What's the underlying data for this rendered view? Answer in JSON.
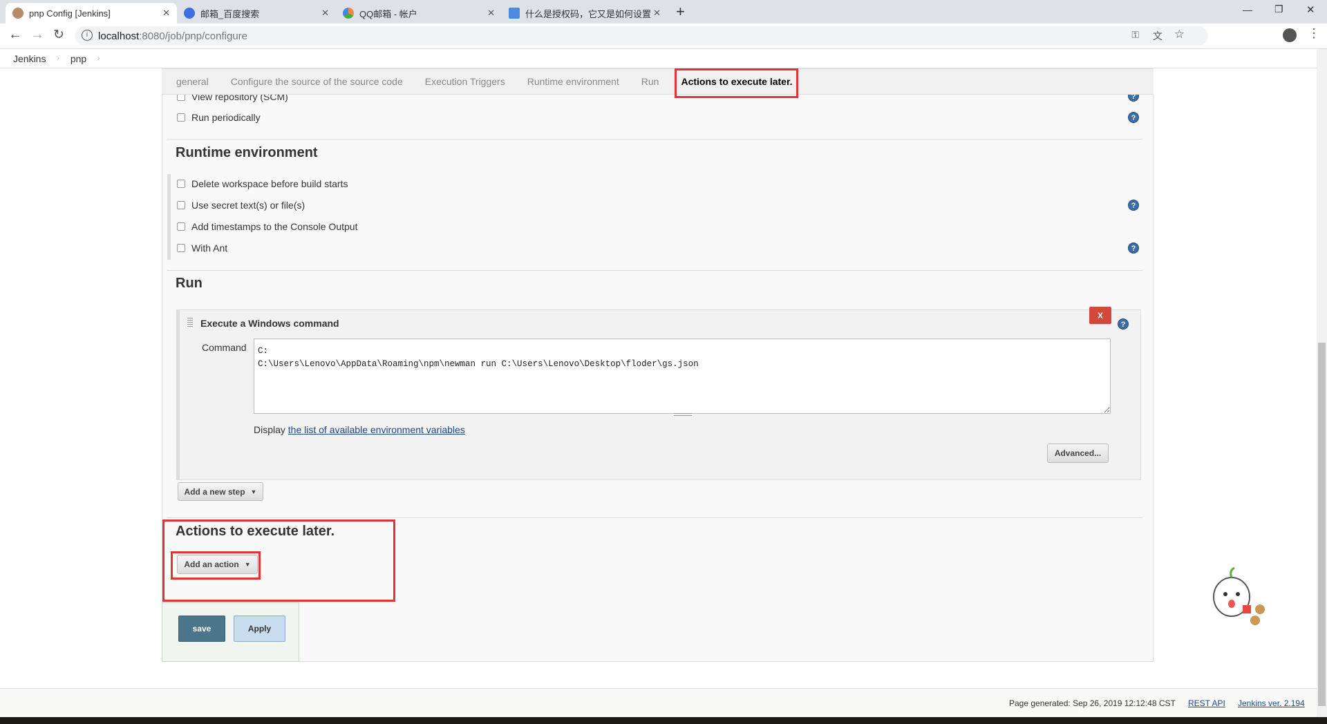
{
  "browser": {
    "tabs": [
      {
        "title": "pnp Config [Jenkins]",
        "active": true
      },
      {
        "title": "邮箱_百度搜索"
      },
      {
        "title": "QQ邮箱 - 帐户"
      },
      {
        "title": "什么是授权码，它又是如何设置"
      }
    ],
    "new_tab": "+",
    "url_host": "localhost",
    "url_rest": ":8080/job/pnp/configure"
  },
  "breadcrumb": [
    "Jenkins",
    "pnp"
  ],
  "config_tabs": [
    "general",
    "Configure the source of the source code",
    "Execution Triggers",
    "Runtime environment",
    "Run",
    "Actions to execute later."
  ],
  "scm": {
    "items": [
      "View repository (SCM)",
      "Run periodically"
    ]
  },
  "runtime": {
    "heading": "Runtime environment",
    "items": [
      "Delete workspace before build starts",
      "Use secret text(s) or file(s)",
      "Add timestamps to the Console Output",
      "With Ant"
    ]
  },
  "run": {
    "heading": "Run",
    "step_title": "Execute a Windows command",
    "delete_label": "X",
    "command_label": "Command",
    "command_value": "C:\nC:\\Users\\Lenovo\\AppData\\Roaming\\npm\\newman run C:\\Users\\Lenovo\\Desktop\\floder\\gs.json",
    "display_prefix": "Display ",
    "env_link": "the list of available environment variables",
    "advanced": "Advanced...",
    "add_step": "Add a new step"
  },
  "post": {
    "heading": "Actions to execute later.",
    "add_action": "Add an action"
  },
  "buttons": {
    "save": "save",
    "apply": "Apply"
  },
  "footer": {
    "generated": "Page generated: Sep 26, 2019 12:12:48 CST",
    "rest_api": "REST API",
    "version": "Jenkins ver. 2.194"
  },
  "colors": {
    "highlight": "#e53333",
    "save": "#4b758b",
    "help": "#3a6ea5",
    "delete": "#d24939"
  }
}
